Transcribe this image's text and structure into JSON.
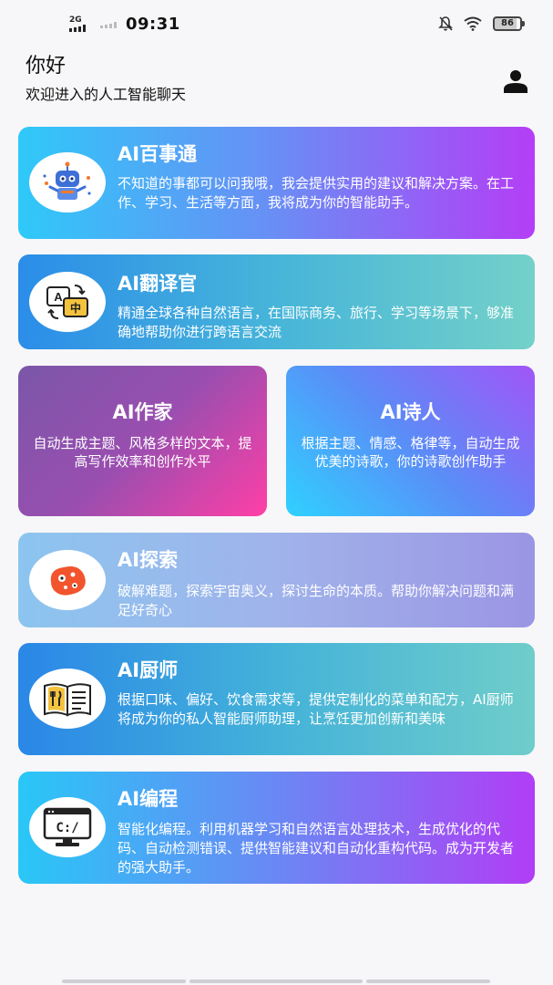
{
  "status_bar": {
    "network": "2G",
    "time": "09:31",
    "battery": "86"
  },
  "header": {
    "greeting": "你好",
    "welcome": "欢迎进入的人工智能聊天"
  },
  "cards": [
    {
      "title": "AI百事通",
      "desc": "不知道的事都可以问我哦，我会提供实用的建议和解决方案。在工作、学习、生活等方面，我将成为你的智能助手。",
      "icon": "robot-icon"
    },
    {
      "title": "AI翻译官",
      "desc": "精通全球各种自然语言，在国际商务、旅行、学习等场景下，够准确地帮助你进行跨语言交流",
      "icon": "translate-icon"
    },
    {
      "title": "AI作家",
      "desc": "自动生成主题、风格多样的文本，提高写作效率和创作水平"
    },
    {
      "title": "AI诗人",
      "desc": "根据主题、情感、格律等，自动生成优美的诗歌，你的诗歌创作助手"
    },
    {
      "title": "AI探索",
      "desc": "破解难题，探索宇宙奥义，探讨生命的本质。帮助你解决问题和满足好奇心",
      "icon": "explore-icon"
    },
    {
      "title": "AI厨师",
      "desc": "根据口味、偏好、饮食需求等，提供定制化的菜单和配方，AI厨师将成为你的私人智能厨师助理，让烹饪更加创新和美味",
      "icon": "recipe-book-icon"
    },
    {
      "title": "AI编程",
      "desc": "智能化编程。利用机器学习和自然语言处理技术，生成优化的代码、自动检测错误、提供智能建议和自动化重构代码。成为开发者的强大助手。",
      "icon": "code-monitor-icon"
    }
  ],
  "colors": {
    "accent_purple": "#b43ef6",
    "accent_cyan": "#2fc9f8",
    "accent_teal": "#74d1c9"
  }
}
